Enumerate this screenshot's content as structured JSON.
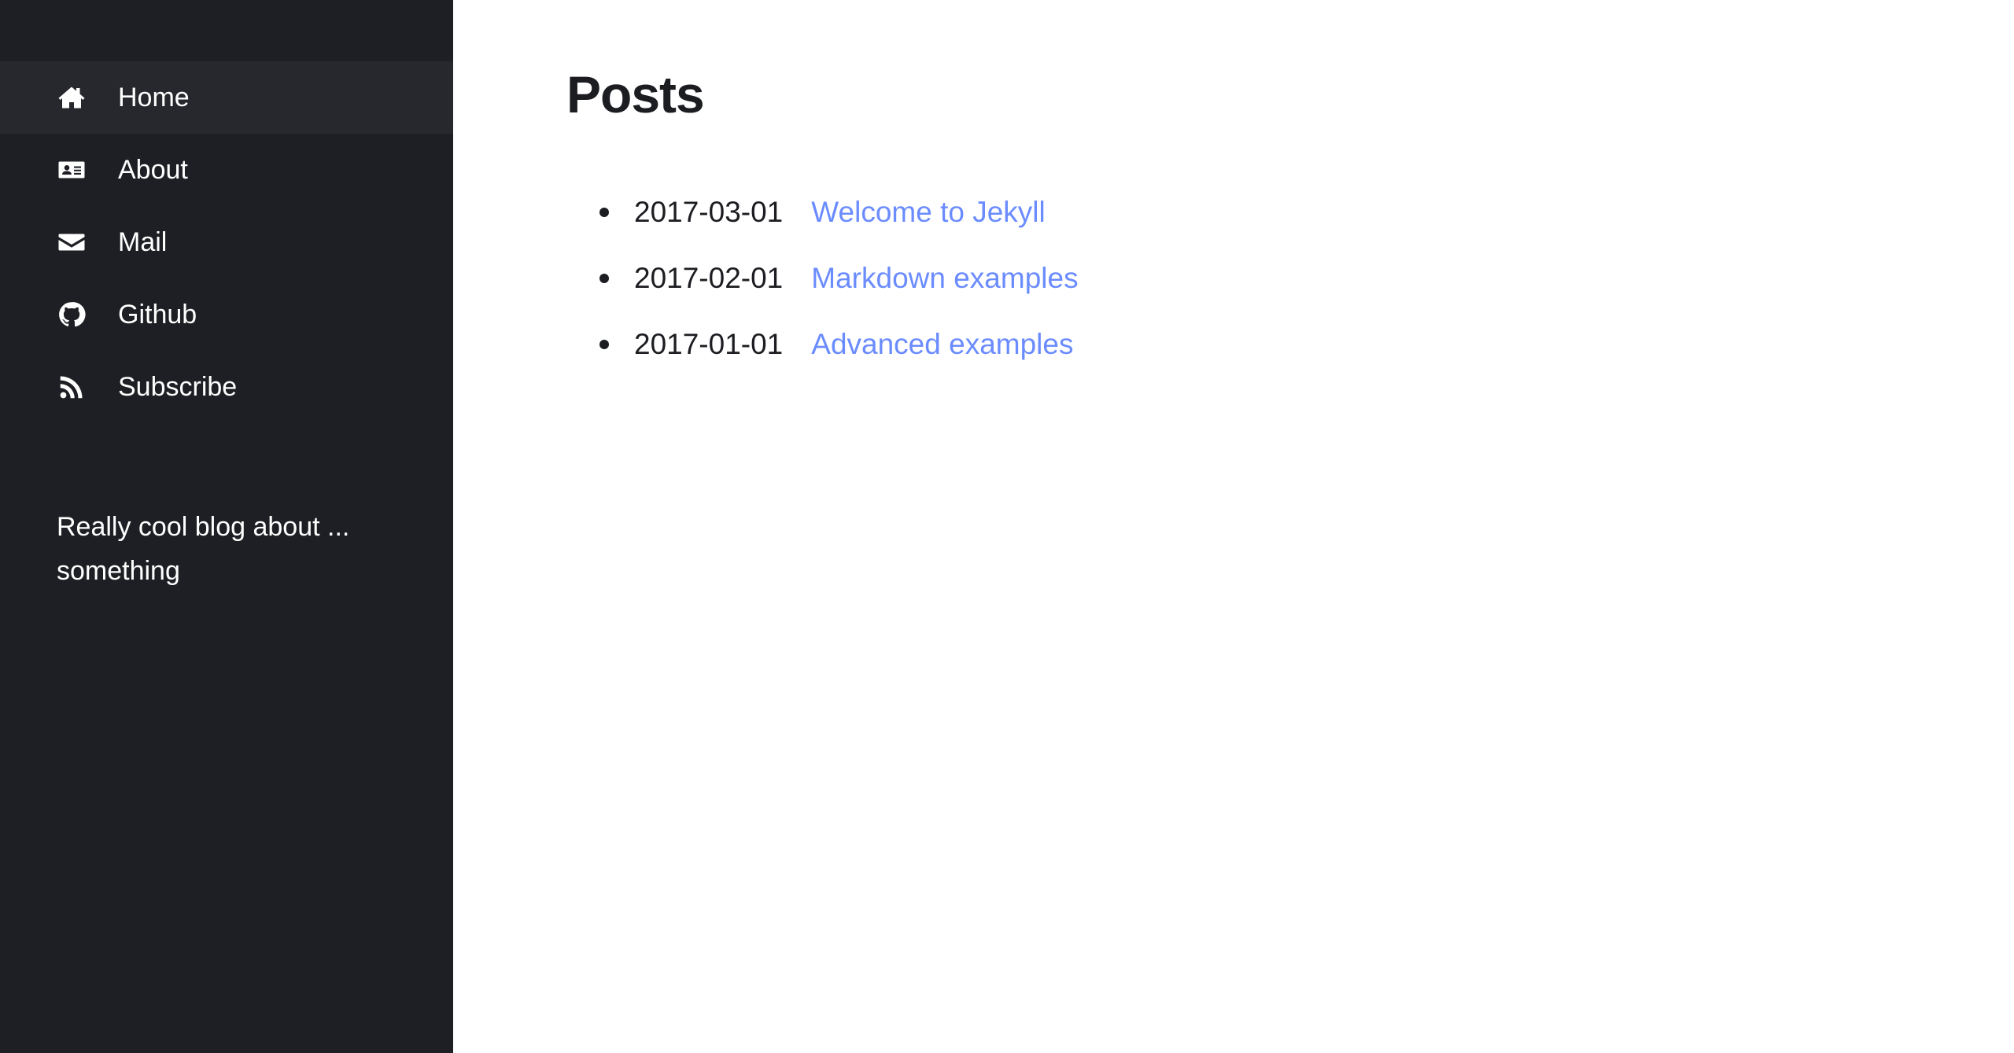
{
  "sidebar": {
    "items": [
      {
        "label": "Home",
        "icon": "home-icon",
        "active": true
      },
      {
        "label": "About",
        "icon": "id-card-icon"
      },
      {
        "label": "Mail",
        "icon": "envelope-icon"
      },
      {
        "label": "Github",
        "icon": "github-icon"
      },
      {
        "label": "Subscribe",
        "icon": "rss-icon"
      }
    ],
    "tagline": "Really cool blog about ... something"
  },
  "main": {
    "title": "Posts",
    "posts": [
      {
        "date": "2017-03-01",
        "title": "Welcome to Jekyll"
      },
      {
        "date": "2017-02-01",
        "title": "Markdown examples"
      },
      {
        "date": "2017-01-01",
        "title": "Advanced examples"
      }
    ]
  },
  "colors": {
    "sidebar_bg": "#1e1f24",
    "active_bg": "#27282e",
    "link": "#6b8cff",
    "text": "#1c1d21"
  }
}
